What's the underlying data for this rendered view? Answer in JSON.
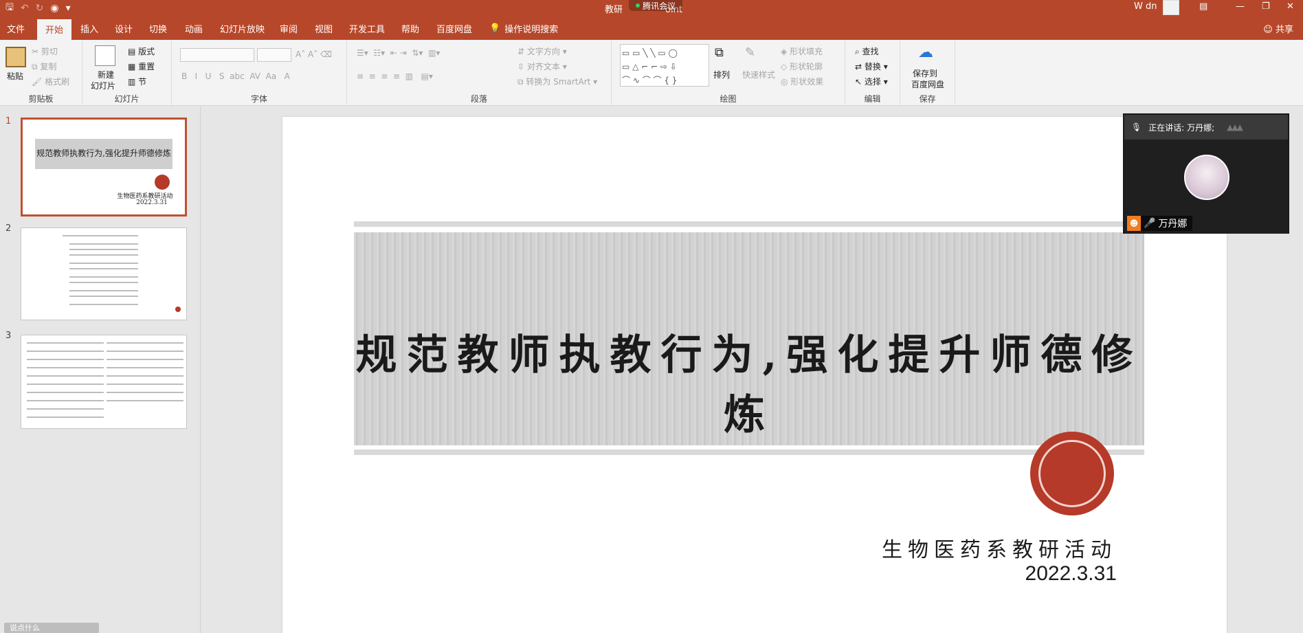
{
  "titlebar": {
    "title": "教研",
    "title_tail": "oint",
    "meeting_chip": "腾讯会议",
    "user": "W dn"
  },
  "menu": {
    "tabs": [
      "文件",
      "开始",
      "插入",
      "设计",
      "切换",
      "动画",
      "幻灯片放映",
      "审阅",
      "视图",
      "开发工具",
      "帮助",
      "百度网盘"
    ],
    "active": "开始",
    "tell_me": "操作说明搜索",
    "share": "共享"
  },
  "ribbon": {
    "clipboard": {
      "label": "剪贴板",
      "paste": "粘贴",
      "cut": "剪切",
      "copy": "复制",
      "format": "格式刷"
    },
    "slides": {
      "label": "幻灯片",
      "new": "新建",
      "new2": "幻灯片",
      "layout": "版式",
      "reset": "重置",
      "section": "节"
    },
    "font": {
      "label": "字体"
    },
    "paragraph": {
      "label": "段落",
      "text_dir": "文字方向",
      "align_text": "对齐文本",
      "smartart": "转换为 SmartArt"
    },
    "drawing": {
      "label": "绘图",
      "arrange": "排列",
      "quick_styles": "快速样式",
      "fill": "形状填充",
      "outline": "形状轮廓",
      "effects": "形状效果"
    },
    "editing": {
      "label": "编辑",
      "find": "查找",
      "replace": "替换",
      "select": "选择"
    },
    "save": {
      "label": "保存",
      "save_to": "保存到",
      "baidu": "百度网盘"
    }
  },
  "thumbnails": [
    {
      "num": "1",
      "title": "规范教师执教行为,强化提升师德修炼",
      "sub": "生物医药系教研活动",
      "date": "2022.3.31"
    },
    {
      "num": "2"
    },
    {
      "num": "3"
    }
  ],
  "slide": {
    "title": "规范教师执教行为,强化提升师德修炼",
    "subtitle": "生物医药系教研活动",
    "date": "2022.3.31"
  },
  "meeting": {
    "speaking": "正在讲话: 万丹娜;",
    "name": "万丹娜"
  },
  "status": {
    "notes_hint": "说点什么"
  },
  "colors": {
    "accent": "#b7472a",
    "seal": "#b53a2a"
  }
}
